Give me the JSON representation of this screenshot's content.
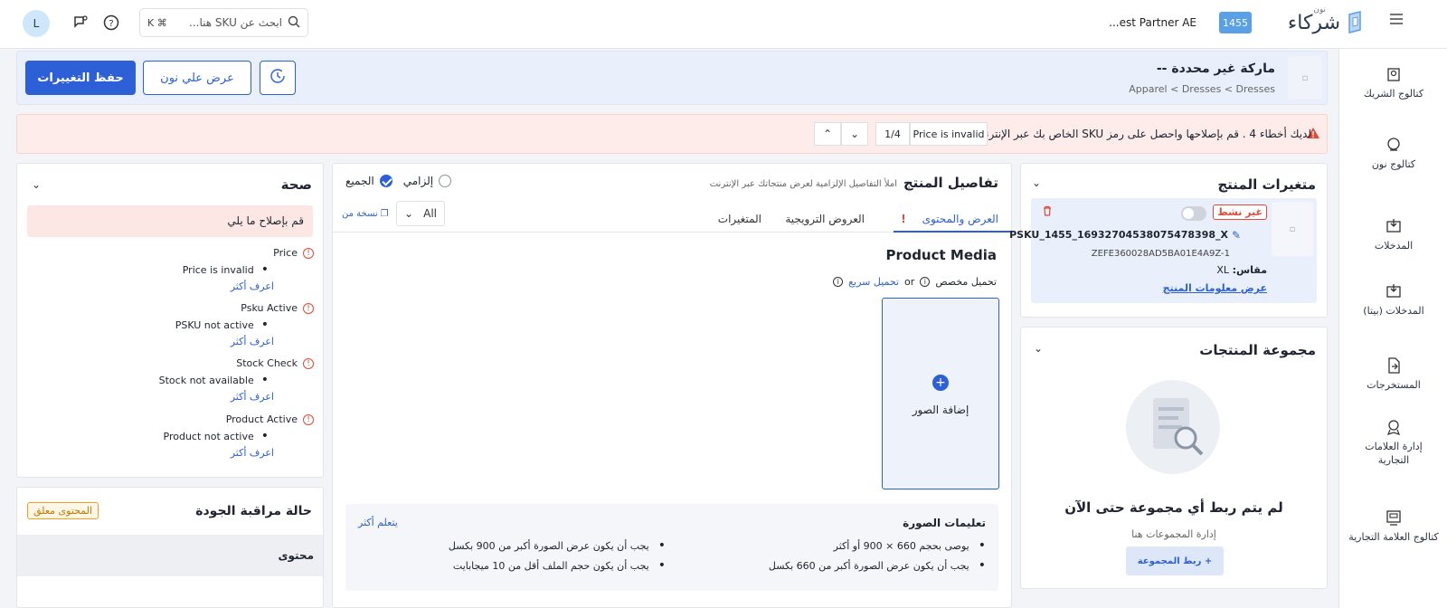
{
  "topbar": {
    "avatar_initial": "L",
    "search_placeholder": "ابحث عن SKU هنا...",
    "search_shortcut": "K ⌘",
    "partner_name": "...est Partner AE",
    "partner_badge": "1455",
    "logo_text": "شركاء",
    "logo_small": "نون"
  },
  "sidebar": {
    "items": [
      {
        "label": "كتالوج الشريك",
        "icon": "partner-catalog-icon"
      },
      {
        "label": "كتالوج نون",
        "icon": "noon-catalog-icon"
      },
      {
        "label": "المدخلات",
        "icon": "inputs-icon"
      },
      {
        "label": "المدخلات (بيتا)",
        "icon": "inputs-beta-icon"
      },
      {
        "label": "المستخرجات",
        "icon": "outputs-icon"
      },
      {
        "label": "إدارة العلامات التجارية",
        "icon": "brand-management-icon"
      },
      {
        "label": "كتالوج العلامة التجارية",
        "icon": "brand-catalog-icon"
      }
    ]
  },
  "header": {
    "brand_title": "ماركة غير محددة --",
    "breadcrumb": "Apparel < Dresses < Dresses",
    "save_label": "حفظ التغييرات",
    "view_label": "عرض علي نون"
  },
  "errors": {
    "message": "لديك أخطاء 4 . قم بإصلاحها واحصل على رمز SKU الخاص بك عبر الإنترنت",
    "current_label": "Price is invalid",
    "counter": "1/4"
  },
  "health": {
    "title": "صحة",
    "alert": "قم بإصلاح ما يلي",
    "learn_more": "اعرف أكثر",
    "issues": [
      {
        "title": "Price",
        "detail": "Price is invalid"
      },
      {
        "title": "Psku Active",
        "detail": "PSKU not active"
      },
      {
        "title": "Stock Check",
        "detail": "Stock not available"
      },
      {
        "title": "Product Active",
        "detail": "Product not active"
      }
    ]
  },
  "qc": {
    "title": "حالة مراقبة الجودة",
    "badge": "المحتوى معلق",
    "sub": "محتوى"
  },
  "details": {
    "title": "تفاصيل المنتج",
    "subtitle": "املأ التفاصيل الإلزامية لعرض منتجاتك عبر الإنترنت",
    "radio_mandatory": "إلزامي",
    "radio_all": "الجميع",
    "tabs": [
      "العرض والمحتوى",
      "العروض الترويجية",
      "المتغيرات"
    ],
    "filter_value": "All",
    "copy_from": "نسخة من",
    "media_title": "Product Media",
    "upload_custom": "تحميل مخصص",
    "upload_or": "or",
    "upload_quick": "تحميل سريع",
    "add_images": "إضافة الصور",
    "instr_title": "تعليمات الصورة",
    "instr_more": "يتعلم أكثر",
    "instructions": [
      "يوصى بحجم 660 × 900 أو أكثر",
      "يجب أن يكون عرض الصورة أكبر من 660 بكسل",
      "يجب أن يكون عرض الصورة أكبر من 900 بكسل",
      "يجب أن يكون حجم الملف أقل من 10 ميجابايت"
    ]
  },
  "variants": {
    "title": "متغيرات المنتج",
    "status": "غير نشط",
    "sku": "PSKU_1455_16932704538075478398_X",
    "code": "ZEFE360028AD5BA01E4A9Z-1",
    "size_label": "مقاس:",
    "size_value": "XL",
    "view_info": "عرض معلومات المنتج"
  },
  "group": {
    "title": "مجموعة المنتجات",
    "empty": "لم يتم ربط أي مجموعة حتى الآن",
    "manage": "إدارة المجموعات هنا",
    "link_button": "+ ربط المجموعة"
  },
  "colors": {
    "primary": "#2d5fd6",
    "error_bg": "#fdecea",
    "header_bg": "#e9effb",
    "pending": "#f0a020"
  }
}
